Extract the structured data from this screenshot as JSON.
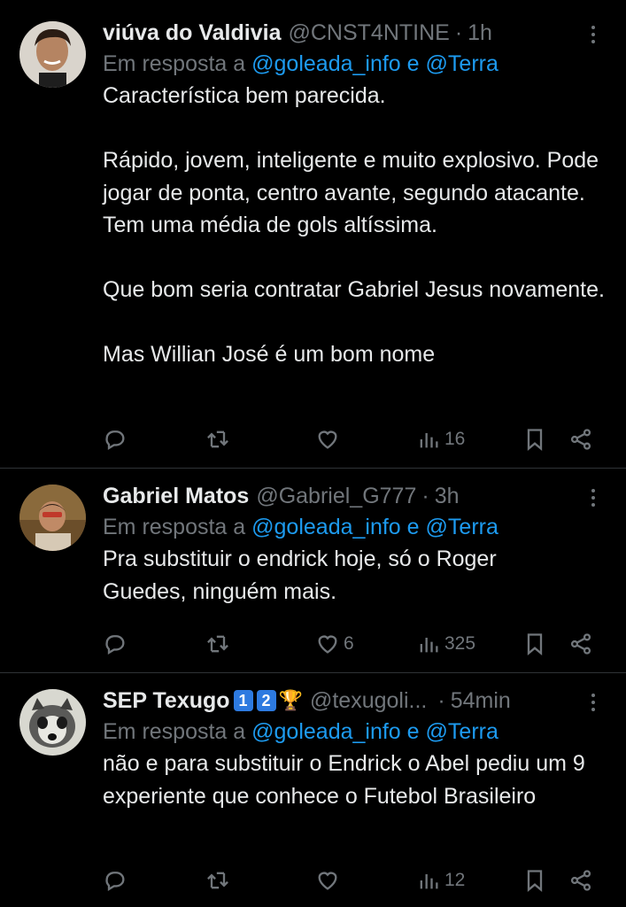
{
  "tweets": [
    {
      "name": "viúva do Valdivia",
      "handle": "@CNST4NTINE",
      "time": "1h",
      "reply_prefix": "Em resposta a",
      "reply_to1": "@goleada_info",
      "reply_and": "e",
      "reply_to2": "@Terra",
      "paragraphs": [
        "Característica bem parecida.",
        "Rápido, jovem, inteligente e muito explosivo. Pode jogar de ponta, centro avante, segundo atacante. Tem uma média de gols altíssima.",
        "Que bom seria contratar Gabriel Jesus novamente.",
        "Mas Willian José é um bom nome"
      ],
      "likes": "",
      "views": "16"
    },
    {
      "name": "Gabriel Matos",
      "handle": "@Gabriel_G777",
      "time": "3h",
      "reply_prefix": "Em resposta a",
      "reply_to1": "@goleada_info",
      "reply_and": "e",
      "reply_to2": "@Terra",
      "paragraphs": [
        "Pra substituir o endrick hoje, só o Roger Guedes, ninguém mais."
      ],
      "likes": "6",
      "views": "325"
    },
    {
      "name": "SEP Texugo",
      "badge1": "1",
      "badge2": "2",
      "trophy": "🏆",
      "handle": "@texugoli...",
      "time": "54min",
      "reply_prefix": "Em resposta a",
      "reply_to1": "@goleada_info",
      "reply_and": "e",
      "reply_to2": "@Terra",
      "paragraphs": [
        "não e para substituir o Endrick o Abel pediu um 9 experiente que conhece o Futebol Brasileiro"
      ],
      "likes": "",
      "views": "12"
    }
  ],
  "colors": {
    "background": "#000000",
    "text": "#e7e9ea",
    "muted": "#71767b",
    "link": "#1d9bf0",
    "divider": "#2f3336"
  },
  "icons": [
    "reply-icon",
    "retweet-icon",
    "like-icon",
    "views-icon",
    "bookmark-icon",
    "share-icon",
    "more-icon"
  ]
}
